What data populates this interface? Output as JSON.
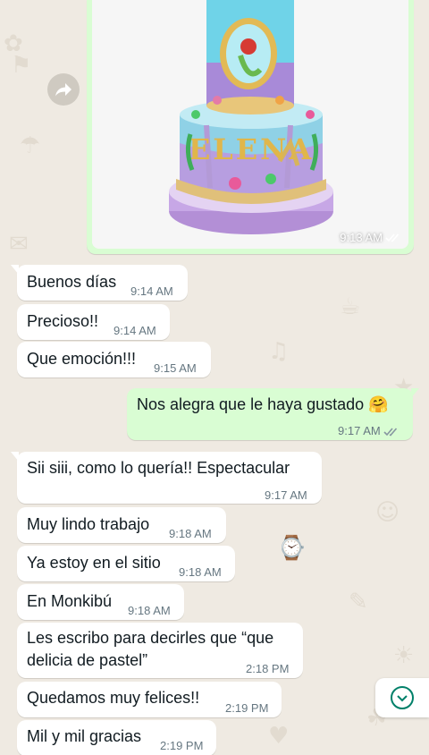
{
  "image_message": {
    "time": "9:13 AM",
    "status": "read",
    "caption_icon": "double-check-icon"
  },
  "messages": [
    {
      "text": "Buenos días",
      "time": "9:14 AM"
    },
    {
      "text": "Precioso!!",
      "time": "9:14 AM"
    },
    {
      "text": "Que emoción!!!",
      "time": "9:15 AM"
    },
    {
      "text": "Nos alegra que le haya gustado 🤗",
      "time": "9:17 AM"
    },
    {
      "text": "Sii siii, como lo quería!!  Espectacular",
      "time": "9:17 AM"
    },
    {
      "text": "Muy lindo trabajo",
      "time": "9:18 AM"
    },
    {
      "text": "Ya estoy en el sitio",
      "time": "9:18 AM"
    },
    {
      "text": "En Monkibú",
      "time": "9:18 AM"
    },
    {
      "text_line1": "Les escribo para decirles que “que",
      "text_line2": "delicia de pastel”",
      "time": "2:18 PM"
    },
    {
      "text": "Quedamos muy felices!!",
      "time": "2:19 PM"
    },
    {
      "text": "Mil y mil gracias",
      "time": "2:19 PM"
    }
  ],
  "cake_text": "ELENA",
  "colors": {
    "wallpaper": "#efeae2",
    "incoming": "#ffffff",
    "outgoing": "#d9fdd3",
    "read_tick": "#53bdeb",
    "accent": "#008069"
  }
}
